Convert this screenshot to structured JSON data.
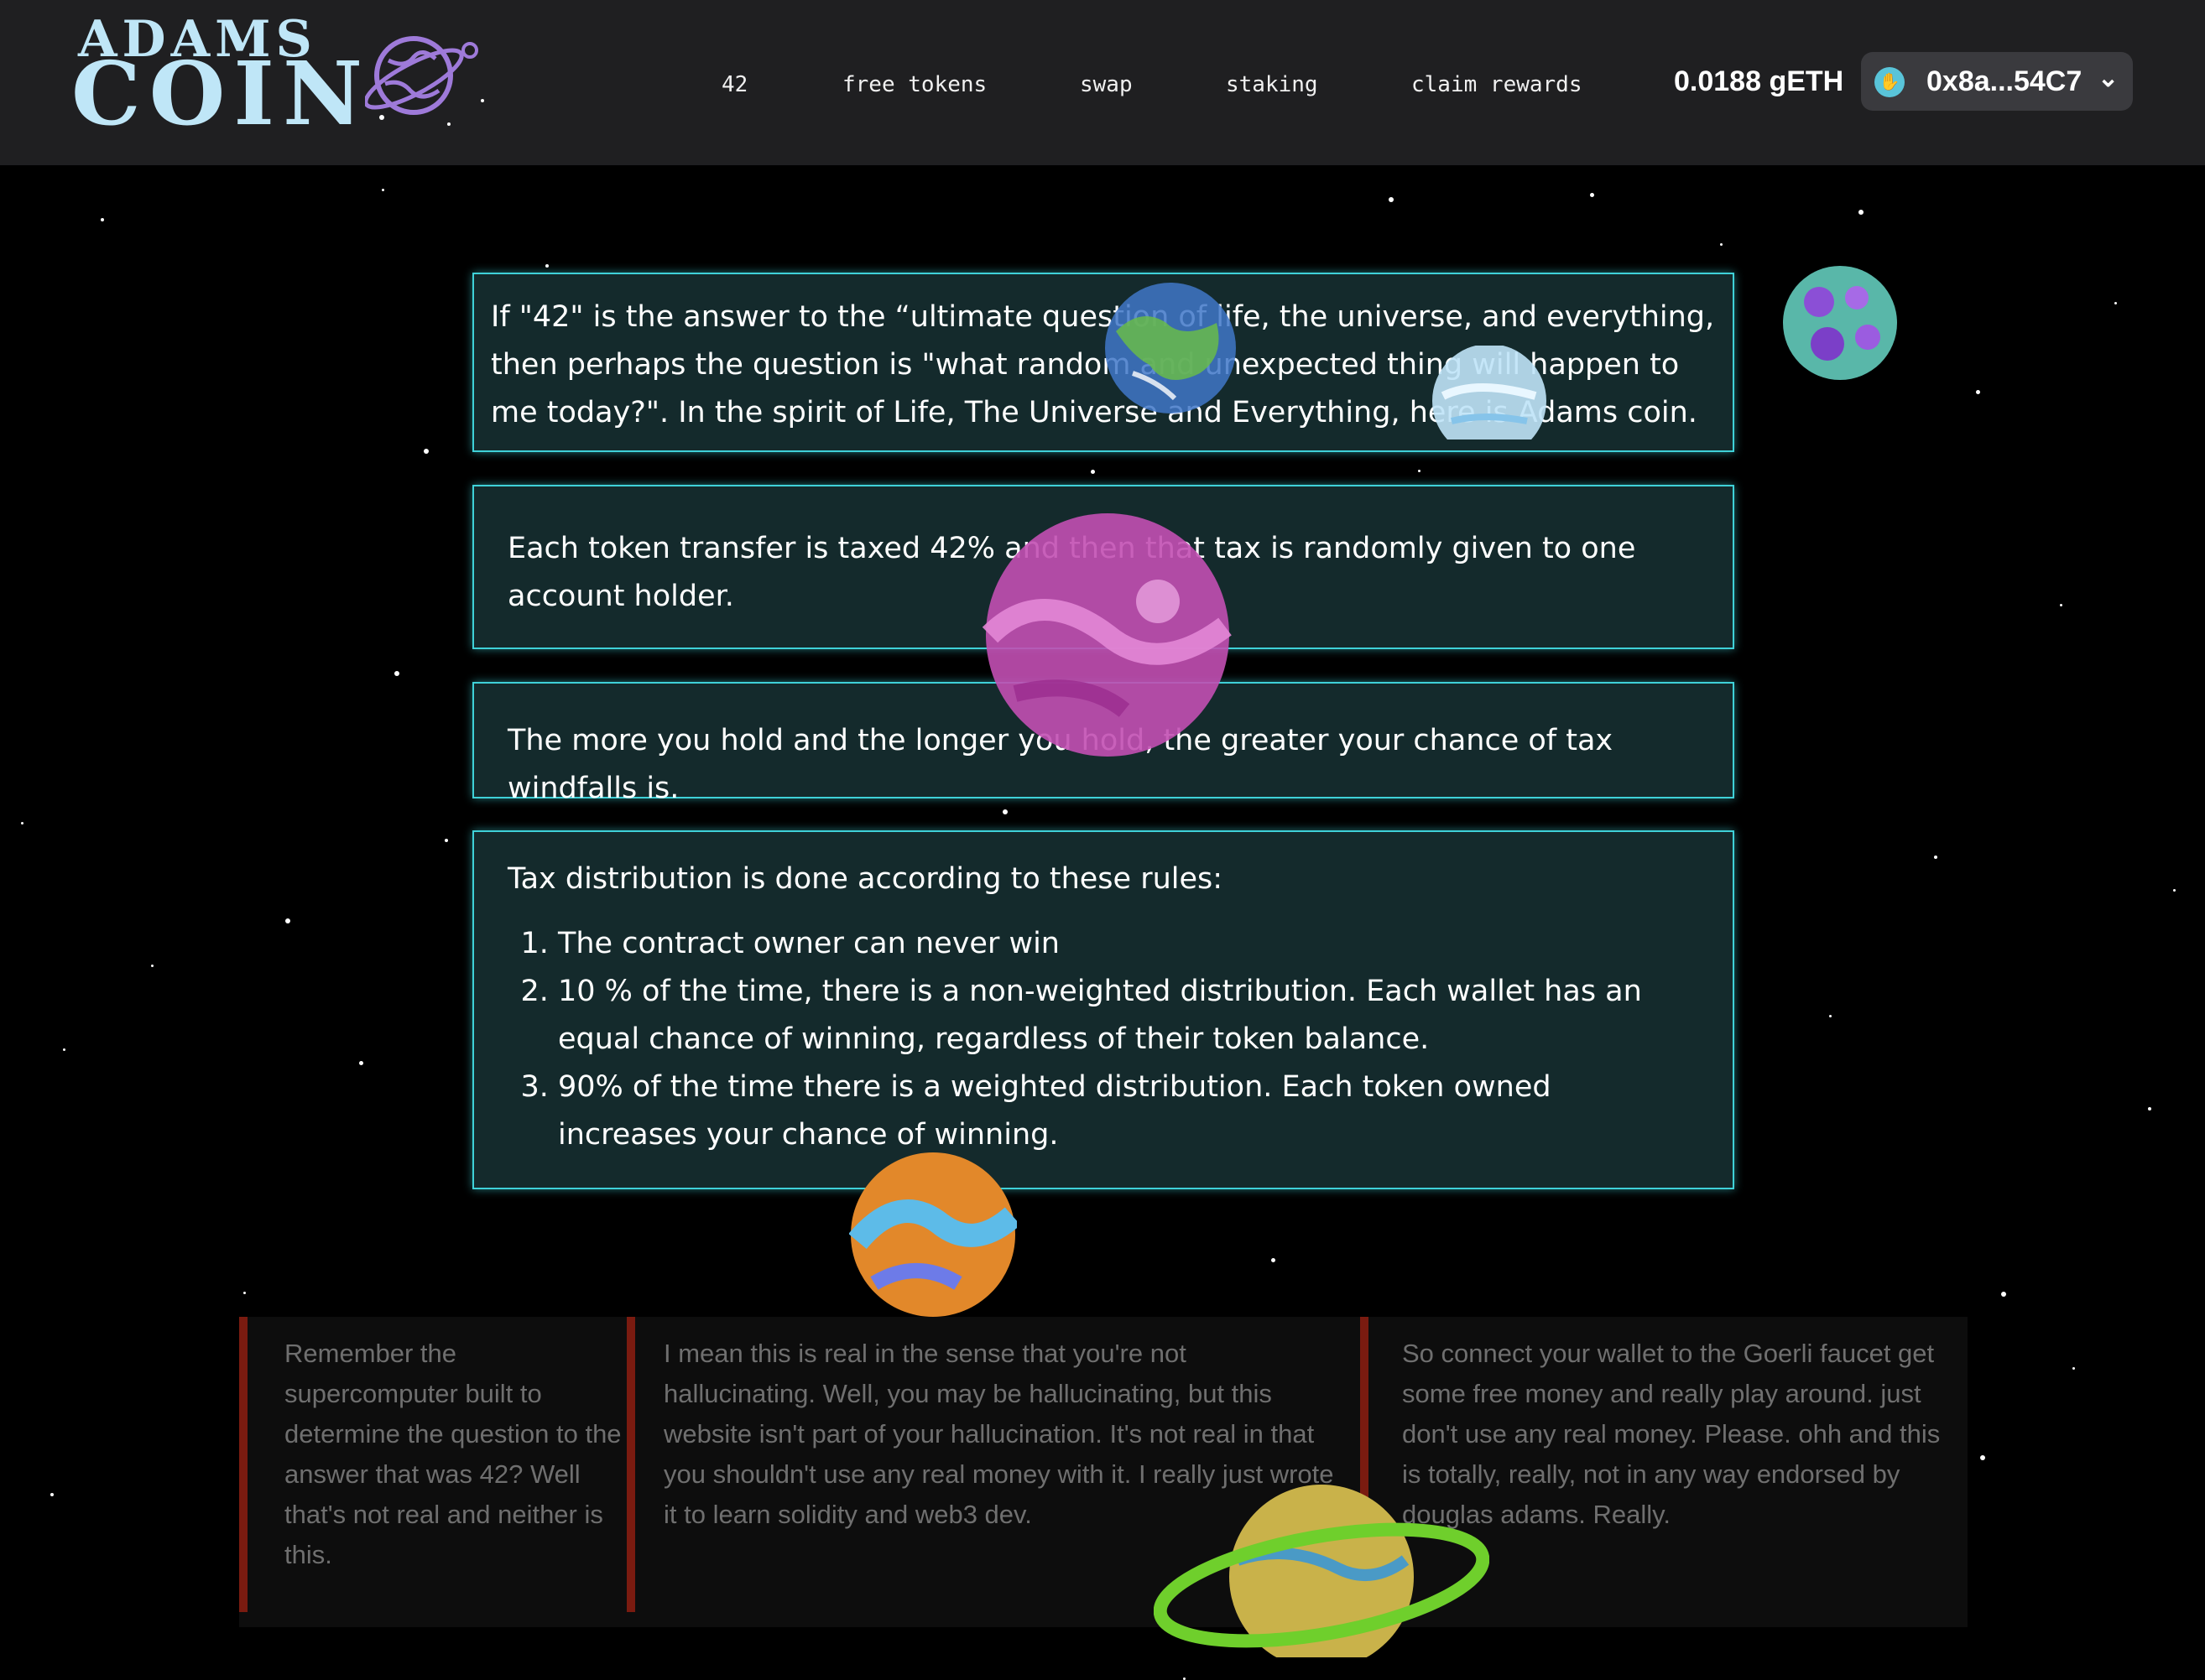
{
  "brand": {
    "line1": "ADAMS",
    "line2": "COIN",
    "accent_color": "#bfe6f7",
    "icon": "planet-logo-icon"
  },
  "nav": {
    "items": [
      {
        "label": "42"
      },
      {
        "label": "free tokens"
      },
      {
        "label": "swap"
      },
      {
        "label": "staking"
      },
      {
        "label": "claim rewards"
      }
    ]
  },
  "account": {
    "balance": "0.0188 gETH",
    "address": "0x8a...54C7",
    "avatar_icon": "wallet-avatar-icon",
    "dropdown_icon": "chevron-down-icon"
  },
  "info": {
    "intro": "If \"42\" is the answer to the “ultimate question of life, the universe, and everything, then perhaps the question is \"what random and unexpected thing will happen to me today?\". In the spirit of Life, The Universe and Everything, here is Adams coin.",
    "tax": "Each token transfer is taxed 42% and then that tax is randomly given to one account holder.",
    "hold": "The more you hold and the longer you hold, the greater your chance of tax windfalls is.",
    "rules_heading": "Tax distribution is done according to these rules:",
    "rules": [
      "The contract owner can never win",
      "10 % of the time, there is a non-weighted distribution. Each wallet has an equal chance of winning, regardless of their token balance.",
      "90% of the time there is a weighted distribution. Each token owned increases your chance of winning."
    ],
    "border_color": "#3fd1d8",
    "box_color": "#142a2c"
  },
  "quotes": [
    "Remember the supercomputer built to determine the question to the answer that was 42? Well that's not real and neither is this.",
    "I mean this is real in the sense that you're not hallucinating. Well, you may be hallucinating, but this website isn't part of your hallucination. It's not real in that you shouldn't use any real money with it. I really just wrote it to learn solidity and web3 dev.",
    "So connect your wallet to the Goerli faucet get some free money and really play around. just don't use any real money. Please. ohh and this is totally, really, not in any way endorsed by douglas adams. Really."
  ]
}
